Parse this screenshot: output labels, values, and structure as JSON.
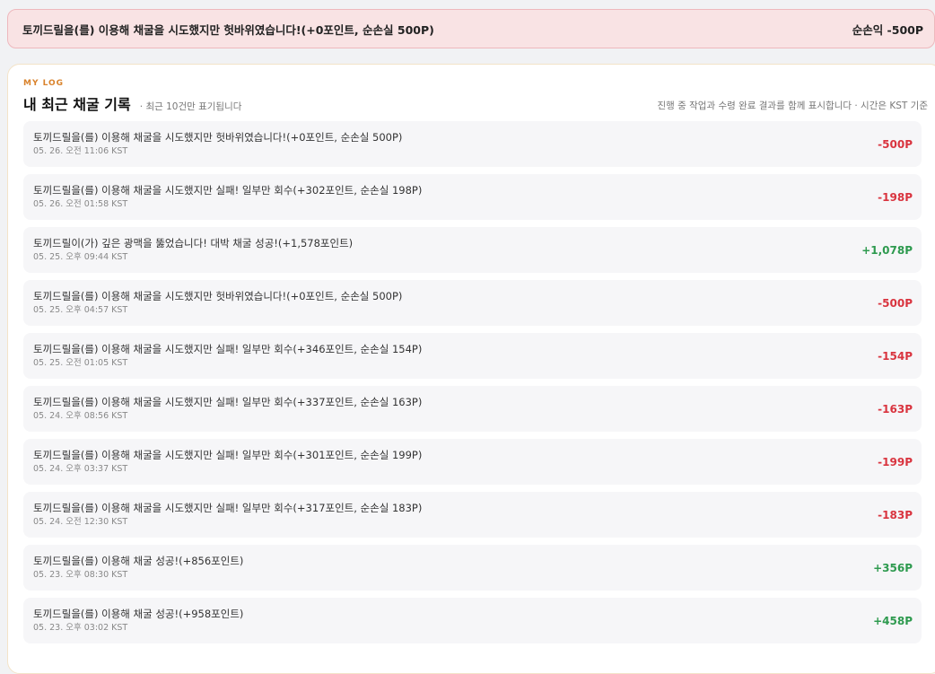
{
  "banner": {
    "message": "토끼드릴을(를) 이용해 채굴을 시도했지만 헛바위였습니다!(+0포인트, 순손실 500P)",
    "net": "순손익 -500P"
  },
  "log": {
    "eyebrow": "MY LOG",
    "title": "내 최근 채굴 기록",
    "subtitle": "· 최근 10건만 표기됩니다",
    "note": "진행 중 작업과 수령 완료 결과를 함께 표시합니다 · 시간은 KST 기준",
    "colors": {
      "negative": "#d9343f",
      "positive": "#2e9a4f"
    },
    "items": [
      {
        "message": "토끼드릴을(를) 이용해 채굴을 시도했지만 헛바위였습니다!(+0포인트, 순손실 500P)",
        "time": "05. 26. 오전 11:06 KST",
        "amount": "-500P",
        "sign": "neg"
      },
      {
        "message": "토끼드릴을(를) 이용해 채굴을 시도했지만 실패! 일부만 회수(+302포인트, 순손실 198P)",
        "time": "05. 26. 오전 01:58 KST",
        "amount": "-198P",
        "sign": "neg"
      },
      {
        "message": "토끼드릴이(가) 깊은 광맥을 뚫었습니다! 대박 채굴 성공!(+1,578포인트)",
        "time": "05. 25. 오후 09:44 KST",
        "amount": "+1,078P",
        "sign": "pos"
      },
      {
        "message": "토끼드릴을(를) 이용해 채굴을 시도했지만 헛바위였습니다!(+0포인트, 순손실 500P)",
        "time": "05. 25. 오후 04:57 KST",
        "amount": "-500P",
        "sign": "neg"
      },
      {
        "message": "토끼드릴을(를) 이용해 채굴을 시도했지만 실패! 일부만 회수(+346포인트, 순손실 154P)",
        "time": "05. 25. 오전 01:05 KST",
        "amount": "-154P",
        "sign": "neg"
      },
      {
        "message": "토끼드릴을(를) 이용해 채굴을 시도했지만 실패! 일부만 회수(+337포인트, 순손실 163P)",
        "time": "05. 24. 오후 08:56 KST",
        "amount": "-163P",
        "sign": "neg"
      },
      {
        "message": "토끼드릴을(를) 이용해 채굴을 시도했지만 실패! 일부만 회수(+301포인트, 순손실 199P)",
        "time": "05. 24. 오후 03:37 KST",
        "amount": "-199P",
        "sign": "neg"
      },
      {
        "message": "토끼드릴을(를) 이용해 채굴을 시도했지만 실패! 일부만 회수(+317포인트, 순손실 183P)",
        "time": "05. 24. 오전 12:30 KST",
        "amount": "-183P",
        "sign": "neg"
      },
      {
        "message": "토끼드릴을(를) 이용해 채굴 성공!(+856포인트)",
        "time": "05. 23. 오후 08:30 KST",
        "amount": "+356P",
        "sign": "pos"
      },
      {
        "message": "토끼드릴을(를) 이용해 채굴 성공!(+958포인트)",
        "time": "05. 23. 오후 03:02 KST",
        "amount": "+458P",
        "sign": "pos"
      }
    ]
  }
}
